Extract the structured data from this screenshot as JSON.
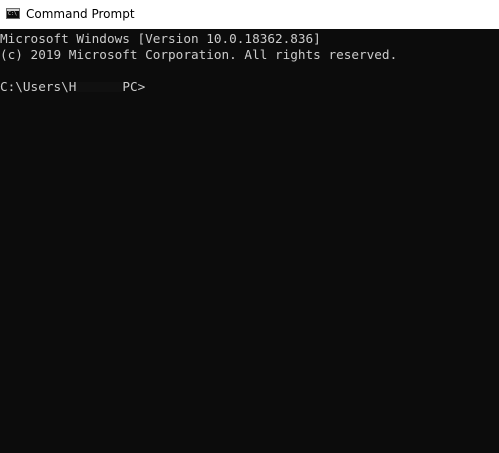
{
  "window": {
    "title": "Command Prompt",
    "icon": "console-icon",
    "icon_text": "C:\\"
  },
  "console": {
    "lines": [
      "Microsoft Windows [Version 10.0.18362.836]",
      "(c) 2019 Microsoft Corporation. All rights reserved."
    ],
    "prompt_prefix": "C:\\Users\\H",
    "prompt_suffix": "PC>"
  },
  "colors": {
    "background": "#0c0c0c",
    "text": "#cccccc",
    "titlebar": "#ffffff"
  }
}
